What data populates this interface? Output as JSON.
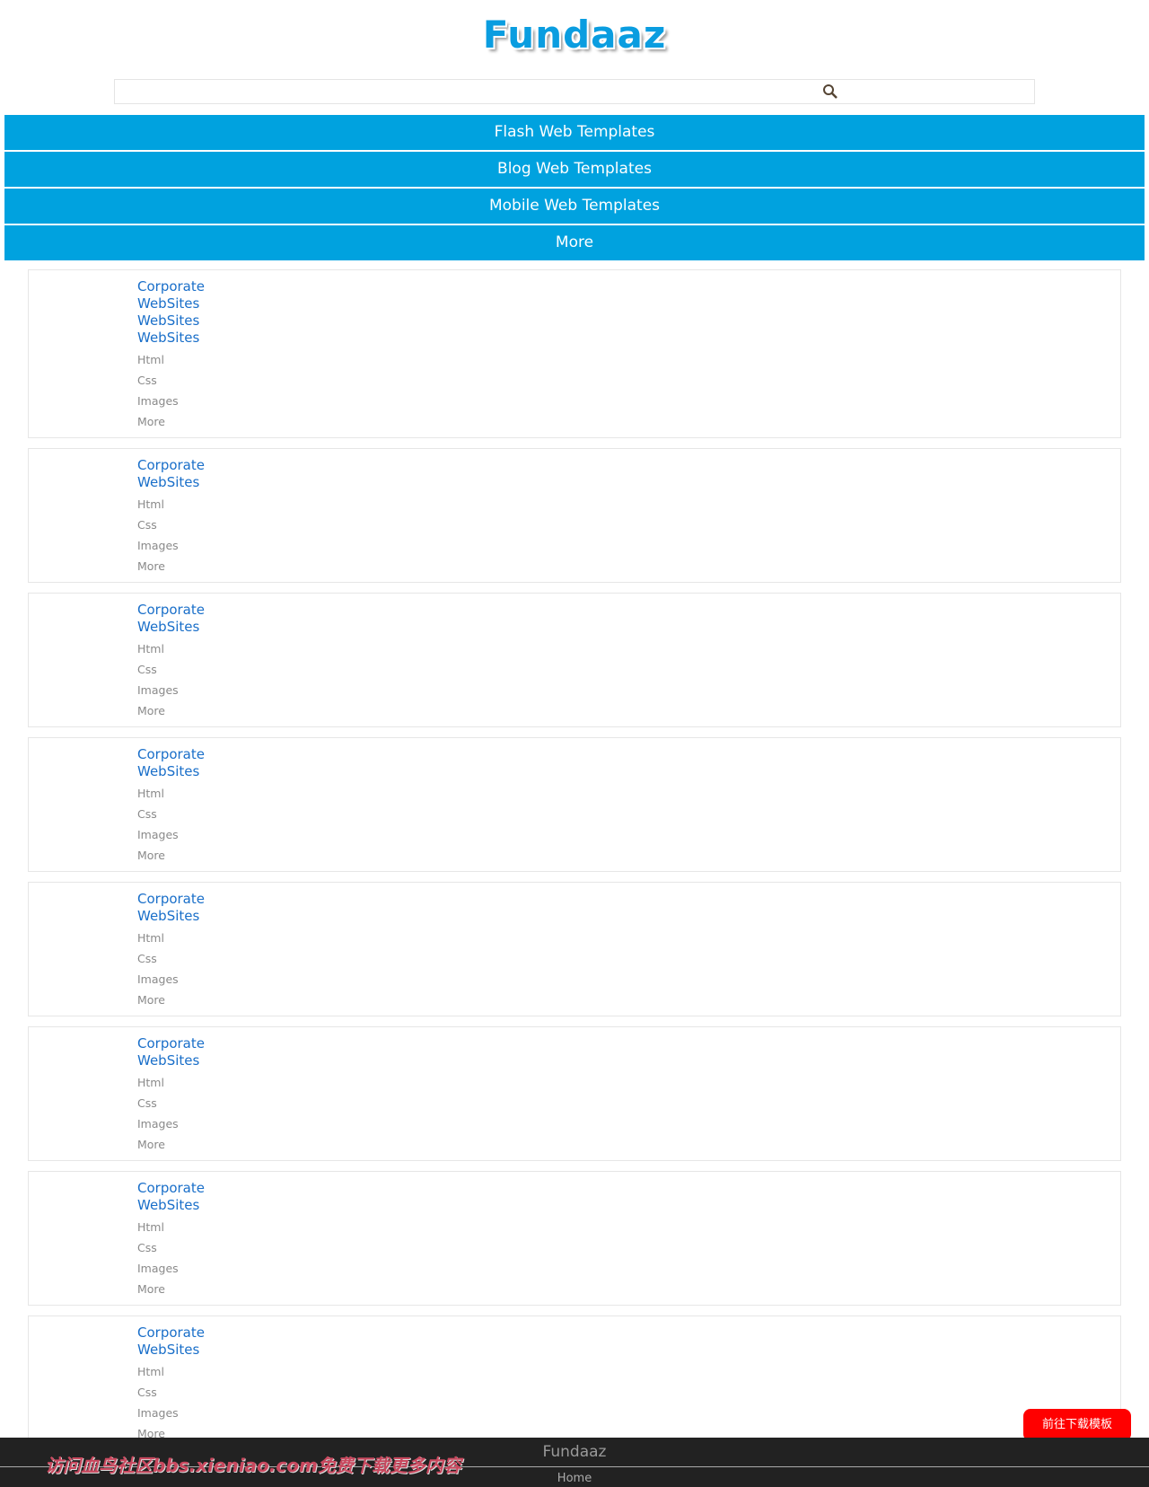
{
  "header": {
    "logo": "Fundaaz",
    "search_placeholder": "",
    "search_icon": "search-icon"
  },
  "nav": [
    "Flash Web Templates",
    "Blog Web Templates",
    "Mobile Web Templates",
    "More"
  ],
  "cards": [
    {
      "titles": [
        "Corporate",
        "WebSites",
        "WebSites",
        "WebSites"
      ],
      "links": [
        "Html",
        "Css",
        "Images",
        "More"
      ]
    },
    {
      "titles": [
        "Corporate",
        "WebSites"
      ],
      "links": [
        "Html",
        "Css",
        "Images",
        "More"
      ]
    },
    {
      "titles": [
        "Corporate",
        "WebSites"
      ],
      "links": [
        "Html",
        "Css",
        "Images",
        "More"
      ]
    },
    {
      "titles": [
        "Corporate",
        "WebSites"
      ],
      "links": [
        "Html",
        "Css",
        "Images",
        "More"
      ]
    },
    {
      "titles": [
        "Corporate",
        "WebSites"
      ],
      "links": [
        "Html",
        "Css",
        "Images",
        "More"
      ]
    },
    {
      "titles": [
        "Corporate",
        "WebSites"
      ],
      "links": [
        "Html",
        "Css",
        "Images",
        "More"
      ]
    },
    {
      "titles": [
        "Corporate",
        "WebSites"
      ],
      "links": [
        "Html",
        "Css",
        "Images",
        "More"
      ]
    },
    {
      "titles": [
        "Corporate",
        "WebSites"
      ],
      "links": [
        "Html",
        "Css",
        "Images",
        "More"
      ]
    }
  ],
  "download_button": "前往下载模板",
  "footer": {
    "title": "Fundaaz",
    "home": "Home",
    "watermark": "访问血鸟社区bbs.xieniao.com免费下载更多内容"
  },
  "colors": {
    "nav": "#00a2df",
    "link": "#1a6fc9",
    "download": "#ff0000",
    "footer": "#222222"
  }
}
